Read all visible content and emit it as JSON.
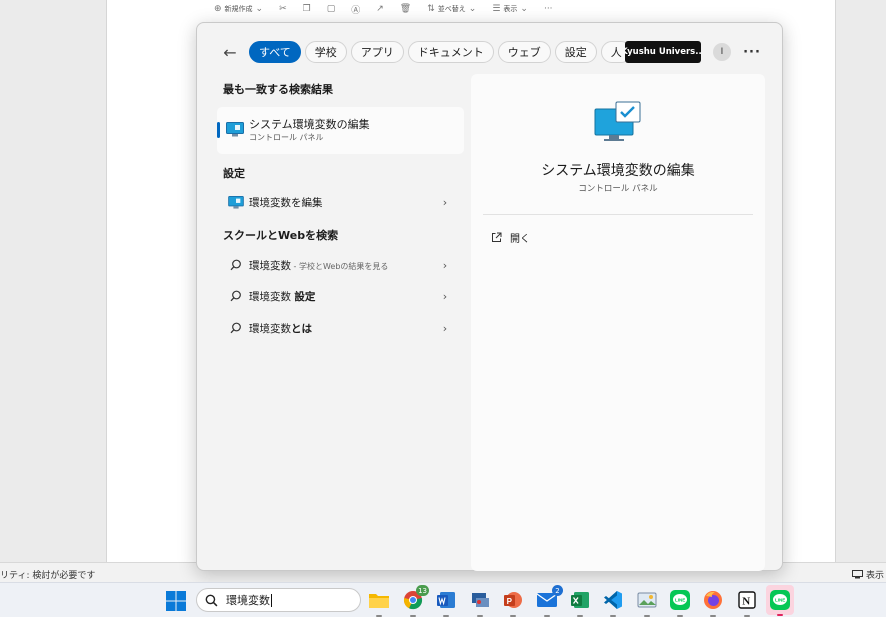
{
  "explorer": {
    "toolbar": [
      {
        "icon": "new-icon",
        "label": "新規作成"
      },
      {
        "icon": "cut-icon",
        "label": ""
      },
      {
        "icon": "copy-icon",
        "label": ""
      },
      {
        "icon": "paste-icon",
        "label": ""
      },
      {
        "icon": "rename-icon",
        "label": ""
      },
      {
        "icon": "share-icon",
        "label": ""
      },
      {
        "icon": "delete-icon",
        "label": ""
      },
      {
        "icon": "sort-icon",
        "label": "並べ替え"
      },
      {
        "icon": "view-icon",
        "label": "表示"
      }
    ],
    "status_left": "リティ: 検討が必要です",
    "status_right": "表示"
  },
  "search_panel": {
    "filters": [
      "すべて",
      "学校",
      "アプリ",
      "ドキュメント",
      "ウェブ",
      "設定",
      "人"
    ],
    "active_filter_index": 0,
    "account_label": "Kyushu Univers...",
    "avatar_initial": "I",
    "best_match": {
      "heading": "最も一致する検索結果",
      "name": "システム環境変数の編集",
      "sub": "コントロール パネル"
    },
    "settings": {
      "heading": "設定",
      "items": [
        {
          "label": "環境変数を編集"
        }
      ]
    },
    "web": {
      "heading": "スクールとWebを検索",
      "items": [
        {
          "main": "環境変数",
          "muted": " - 学校とWebの結果を見る",
          "bold": ""
        },
        {
          "main": "環境変数 ",
          "muted": "",
          "bold": "設定"
        },
        {
          "main": "環境変数",
          "muted": "",
          "bold": "とは"
        }
      ]
    },
    "preview": {
      "title": "システム環境変数の編集",
      "sub": "コントロール パネル",
      "open_label": "開く"
    }
  },
  "taskbar": {
    "search_text": "環境変数",
    "apps": [
      {
        "name": "file-explorer",
        "badge": ""
      },
      {
        "name": "chrome",
        "badge": "13"
      },
      {
        "name": "word",
        "badge": ""
      },
      {
        "name": "remote-desktop",
        "badge": ""
      },
      {
        "name": "powerpoint",
        "badge": ""
      },
      {
        "name": "mail",
        "badge": "2"
      },
      {
        "name": "excel",
        "badge": ""
      },
      {
        "name": "vscode",
        "badge": ""
      },
      {
        "name": "photos",
        "badge": ""
      },
      {
        "name": "line",
        "badge": ""
      },
      {
        "name": "firefox",
        "badge": ""
      },
      {
        "name": "notion",
        "badge": ""
      },
      {
        "name": "line-active",
        "badge": ""
      }
    ]
  },
  "colors": {
    "accent": "#0067c0",
    "panel_bg": "#f3f3f3",
    "taskbar_bg": "#eef1f6"
  }
}
